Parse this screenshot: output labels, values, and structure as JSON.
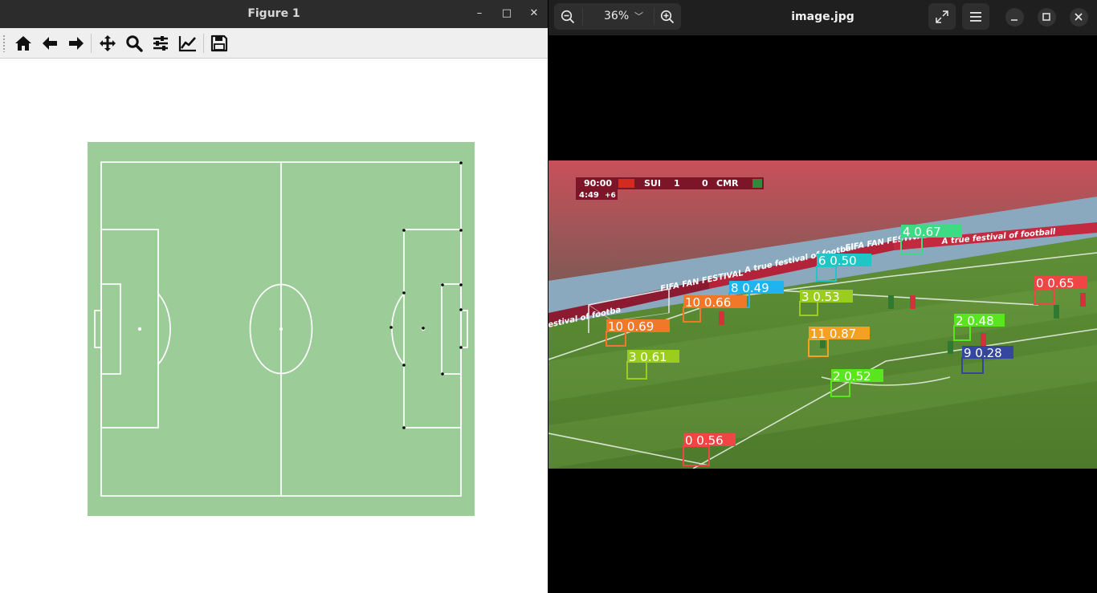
{
  "figure_window": {
    "title": "Figure 1",
    "controls": {
      "minimize": "–",
      "maximize": "□",
      "close": "✕"
    },
    "toolbar": [
      "home-icon",
      "back-arrow-icon",
      "forward-arrow-icon",
      "pan-icon",
      "zoom-magnifier-icon",
      "subplots-sliders-icon",
      "edit-axes-icon",
      "save-floppy-icon"
    ]
  },
  "pitch": {
    "grass_color": "#9ccc98",
    "line_color": "#ffffff",
    "marker_color": "#000000"
  },
  "viewer": {
    "title": "image.jpg",
    "zoom_level": "36%",
    "zoom_caret": "﹀",
    "controls": [
      "zoom-out-icon",
      "zoom-in-icon",
      "fullscreen-icon",
      "menu-icon",
      "minimize-icon",
      "maximize-icon",
      "close-icon"
    ]
  },
  "scoreboard": {
    "clock": "90:00",
    "team_home": "SUI",
    "score_home": "1",
    "score_away": "0",
    "team_away": "CMR",
    "stoppage_clock": "4:49",
    "added_time": "+6"
  },
  "stadium_banners": [
    "FIFA FAN FESTIVAL",
    "A true festival of football",
    "FIFA FAN FESTIVAL",
    "estival of footba",
    "A true festival of football"
  ],
  "detections": [
    {
      "label": "4 0.67",
      "color": "#3ddc84"
    },
    {
      "label": "6 0.50",
      "color": "#1ec6c6"
    },
    {
      "label": "0 0.65",
      "color": "#f04545"
    },
    {
      "label": "8 0.49",
      "color": "#1eb4f0"
    },
    {
      "label": "3 0.53",
      "color": "#9acd1e"
    },
    {
      "label": "10 0.66",
      "color": "#f07828"
    },
    {
      "label": "10 0.69",
      "color": "#f07828"
    },
    {
      "label": "11 0.87",
      "color": "#f5a020"
    },
    {
      "label": "2 0.48",
      "color": "#5ae61e"
    },
    {
      "label": "9 0.28",
      "color": "#34469e"
    },
    {
      "label": "3 0.61",
      "color": "#9acd1e"
    },
    {
      "label": "2 0.52",
      "color": "#5ae61e"
    },
    {
      "label": "0 0.56",
      "color": "#f04545"
    }
  ]
}
